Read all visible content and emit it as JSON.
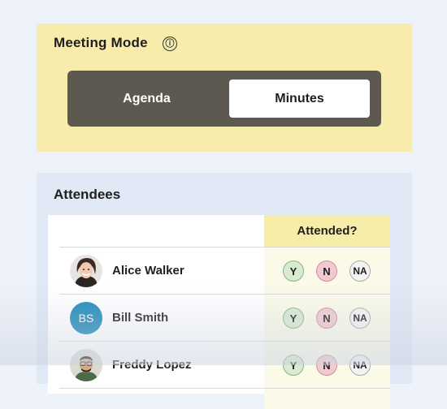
{
  "meeting_mode": {
    "title": "Meeting Mode",
    "info_icon": "ⓘ",
    "options": [
      "Agenda",
      "Minutes"
    ],
    "selected": "Minutes"
  },
  "attendees": {
    "title": "Attendees",
    "column_header": "Attended?",
    "buttons": {
      "yes": "Y",
      "no": "N",
      "na": "NA"
    },
    "rows": [
      {
        "name": "Alice Walker",
        "avatar": "photo"
      },
      {
        "name": "Bill Smith",
        "avatar": "BS"
      },
      {
        "name": "Freddy Lopez",
        "avatar": "photo"
      }
    ]
  },
  "colors": {
    "mode_card_bg": "#f7ecab",
    "segment_bg": "#5d5950",
    "attendees_card_bg": "#e0e7f5",
    "initials_avatar": "#1f8ab8"
  }
}
